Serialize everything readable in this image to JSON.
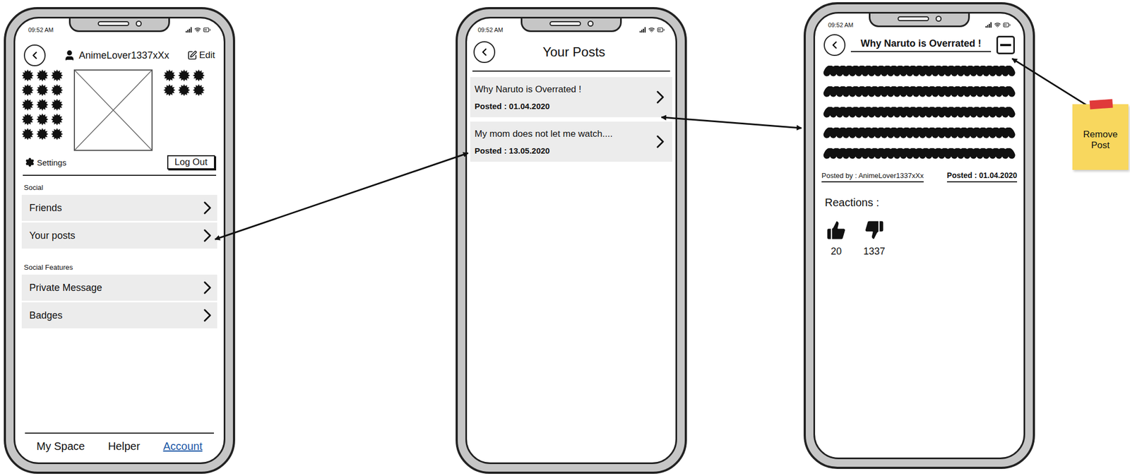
{
  "account": {
    "status_time": "09:52 AM",
    "username": "AnimeLover1337xXx",
    "edit_label": "Edit",
    "settings_label": "Settings",
    "logout_label": "Log Out",
    "sections": [
      {
        "title": "Social",
        "items": [
          {
            "label": "Friends"
          },
          {
            "label": "Your posts"
          }
        ]
      },
      {
        "title": "Social Features",
        "items": [
          {
            "label": "Private Message"
          },
          {
            "label": "Badges"
          }
        ]
      }
    ],
    "nav": [
      {
        "label": "My Space",
        "selected": false
      },
      {
        "label": "Helper",
        "selected": false
      },
      {
        "label": "Account",
        "selected": true
      }
    ]
  },
  "your_posts": {
    "status_time": "09:52 AM",
    "title": "Your Posts",
    "posts": [
      {
        "title": "Why Naruto is Overrated !",
        "date": "Posted : 01.04.2020"
      },
      {
        "title": "My mom does not let me watch....",
        "date": "Posted : 13.05.2020"
      }
    ]
  },
  "post_detail": {
    "status_time": "09:52 AM",
    "title": "Why Naruto is Overrated !",
    "author": "Posted by : AnimeLover1337xXx",
    "date": "Posted : 01.04.2020",
    "reactions_label": "Reactions :",
    "reactions": [
      {
        "kind": "like",
        "count": "20"
      },
      {
        "kind": "dislike",
        "count": "1337"
      }
    ]
  },
  "annotation": {
    "text": "Remove Post"
  }
}
